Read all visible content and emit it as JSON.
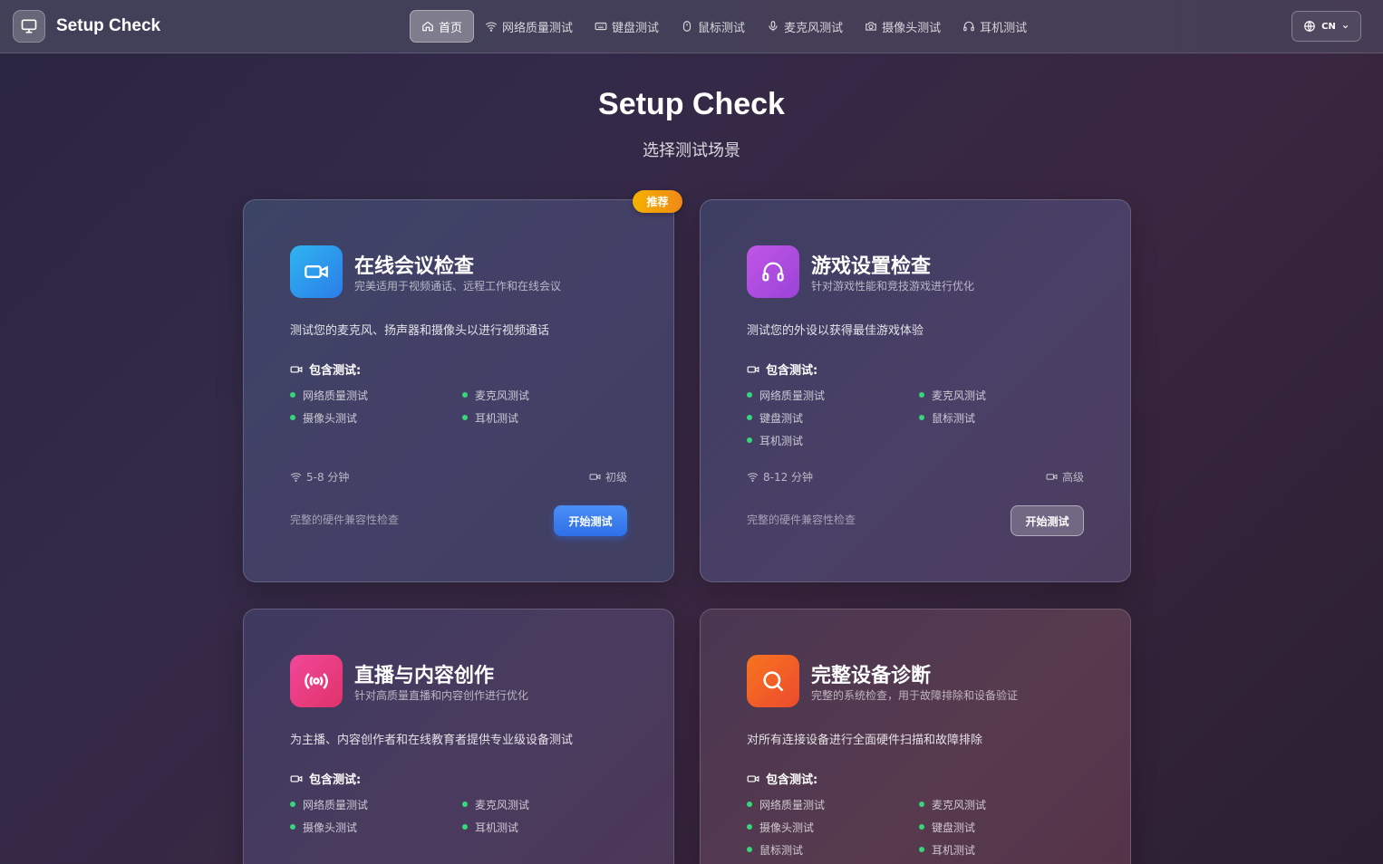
{
  "app": {
    "name": "Setup Check"
  },
  "nav": [
    {
      "label": "首页",
      "icon": "home-icon",
      "active": true
    },
    {
      "label": "网络质量测试",
      "icon": "wifi-icon"
    },
    {
      "label": "键盘测试",
      "icon": "keyboard-icon"
    },
    {
      "label": "鼠标测试",
      "icon": "mouse-icon"
    },
    {
      "label": "麦克风测试",
      "icon": "microphone-icon"
    },
    {
      "label": "摄像头测试",
      "icon": "camera-icon"
    },
    {
      "label": "耳机测试",
      "icon": "headphones-icon"
    }
  ],
  "language": {
    "label": "CN",
    "icon": "globe-icon"
  },
  "hero": {
    "title": "Setup Check",
    "subtitle": "选择测试场景"
  },
  "cards": [
    {
      "badge": "推荐",
      "icon": "video-camera-icon",
      "title": "在线会议检查",
      "subtitle": "完美适用于视频通话、远程工作和在线会议",
      "description": "测试您的麦克风、扬声器和摄像头以进行视频通话",
      "tests_heading": "包含测试:",
      "tests": [
        "网络质量测试",
        "麦克风测试",
        "摄像头测试",
        "耳机测试"
      ],
      "duration": "5-8 分钟",
      "level": "初级",
      "footer": "完整的硬件兼容性检查",
      "button": "开始测试",
      "accent": "#2f9cf0"
    },
    {
      "icon": "headphones-icon",
      "title": "游戏设置检查",
      "subtitle": "针对游戏性能和竞技游戏进行优化",
      "description": "测试您的外设以获得最佳游戏体验",
      "tests_heading": "包含测试:",
      "tests": [
        "网络质量测试",
        "麦克风测试",
        "键盘测试",
        "鼠标测试",
        "耳机测试"
      ],
      "duration": "8-12 分钟",
      "level": "高级",
      "footer": "完整的硬件兼容性检查",
      "button": "开始测试",
      "accent": "#b44fe0"
    },
    {
      "icon": "broadcast-icon",
      "title": "直播与内容创作",
      "subtitle": "针对高质量直播和内容创作进行优化",
      "description": "为主播、内容创作者和在线教育者提供专业级设备测试",
      "tests_heading": "包含测试:",
      "tests": [
        "网络质量测试",
        "麦克风测试",
        "摄像头测试",
        "耳机测试"
      ],
      "accent": "#ec3f7f"
    },
    {
      "icon": "search-icon",
      "title": "完整设备诊断",
      "subtitle": "完整的系统检查，用于故障排除和设备验证",
      "description": "对所有连接设备进行全面硬件扫描和故障排除",
      "tests_heading": "包含测试:",
      "tests": [
        "网络质量测试",
        "麦克风测试",
        "摄像头测试",
        "键盘测试",
        "鼠标测试",
        "耳机测试"
      ],
      "accent": "#f2622a"
    }
  ],
  "colors": {
    "status_dot": "#37d67a",
    "primary_button": "#3b7ff0",
    "badge": "#f5a40c"
  }
}
